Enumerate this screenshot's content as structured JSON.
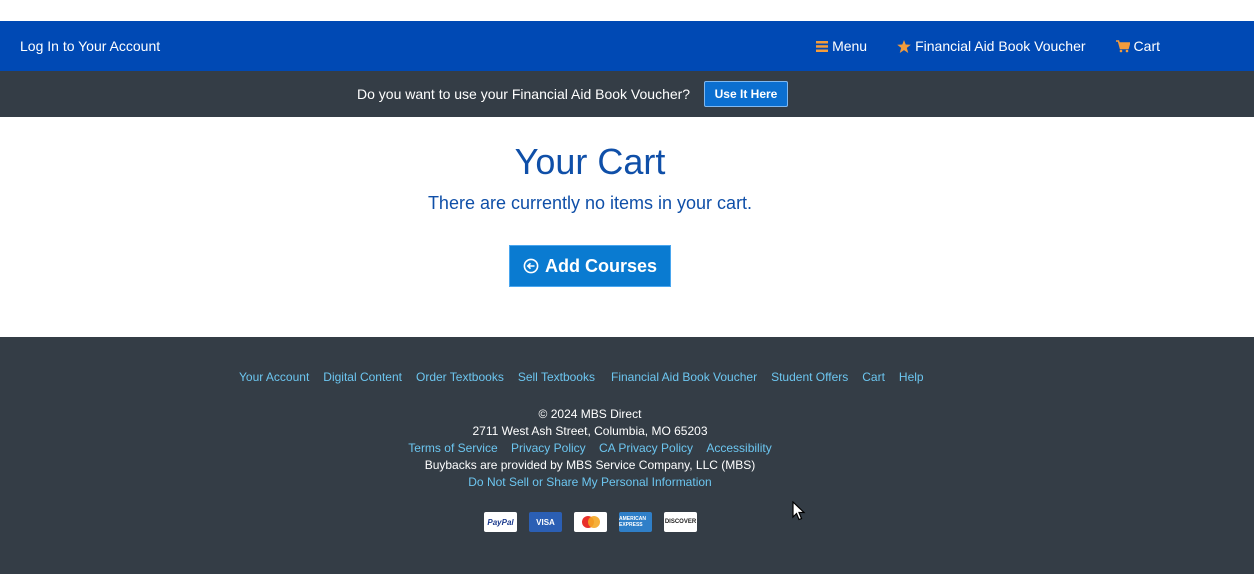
{
  "navbar": {
    "login_label": "Log In to Your Account",
    "menu_label": "Menu",
    "voucher_label": "Financial Aid Book Voucher",
    "cart_label": "Cart",
    "bg_color": "#0049b4",
    "icon_color": "#f39c3c"
  },
  "voucher_bar": {
    "prompt": "Do you want to use your Financial Aid Book Voucher?",
    "button_label": "Use It Here"
  },
  "main": {
    "title": "Your Cart",
    "empty_message": "There are currently no items in your cart.",
    "add_button_label": "Add Courses"
  },
  "footer": {
    "links": [
      "Your Account",
      "Digital Content",
      "Order Textbooks",
      "Sell Textbooks",
      "Financial Aid Book Voucher",
      "Student Offers",
      "Cart",
      "Help"
    ],
    "copyright": "© 2024 MBS Direct",
    "address": "2711 West Ash Street, Columbia, MO 65203",
    "legal_links": [
      "Terms of Service",
      "Privacy Policy",
      "CA Privacy Policy",
      "Accessibility"
    ],
    "buybacks": "Buybacks are provided by MBS Service Company, LLC (MBS)",
    "do_not_sell": "Do Not Sell or Share My Personal Information",
    "payments": {
      "paypal": "PayPal",
      "visa": "VISA",
      "amex": "AMERICAN EXPRESS",
      "discover": "DISCOVER"
    }
  }
}
